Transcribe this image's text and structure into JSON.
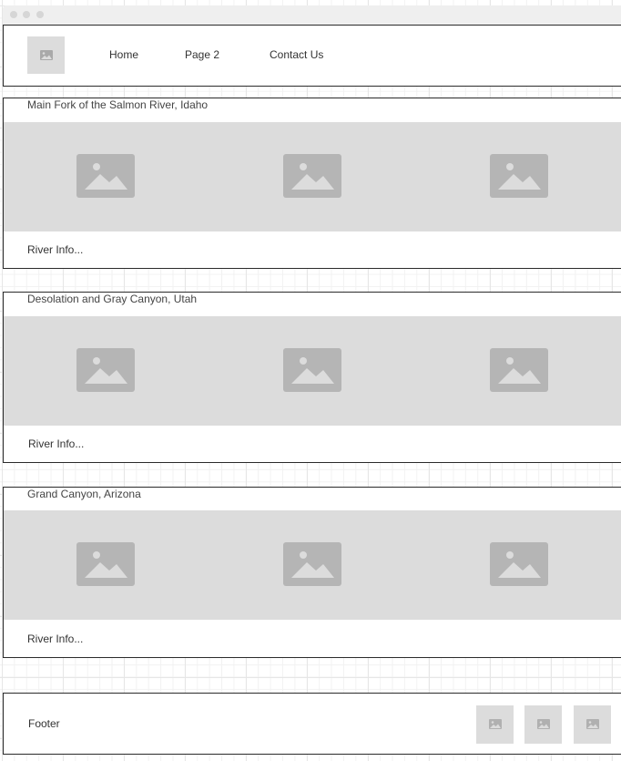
{
  "header": {
    "logo_icon": "image-placeholder-icon",
    "nav": [
      "Home",
      "Page 2",
      "Contact Us"
    ]
  },
  "sections": [
    {
      "title": "Main Fork of the Salmon River, Idaho",
      "link": "River Info...",
      "images": [
        "image-placeholder-icon",
        "image-placeholder-icon",
        "image-placeholder-icon"
      ]
    },
    {
      "title": "Desolation and Gray Canyon, Utah",
      "link": "River Info...",
      "images": [
        "image-placeholder-icon",
        "image-placeholder-icon",
        "image-placeholder-icon"
      ]
    },
    {
      "title": "Grand Canyon, Arizona",
      "link": "River Info...",
      "images": [
        "image-placeholder-icon",
        "image-placeholder-icon",
        "image-placeholder-icon"
      ]
    }
  ],
  "footer": {
    "label": "Footer",
    "images": [
      "image-placeholder-icon",
      "image-placeholder-icon",
      "image-placeholder-icon"
    ]
  },
  "colors": {
    "placeholder_bg": "#dcdcdc",
    "placeholder_icon": "#b5b5b5",
    "border": "#2b2b2b"
  }
}
